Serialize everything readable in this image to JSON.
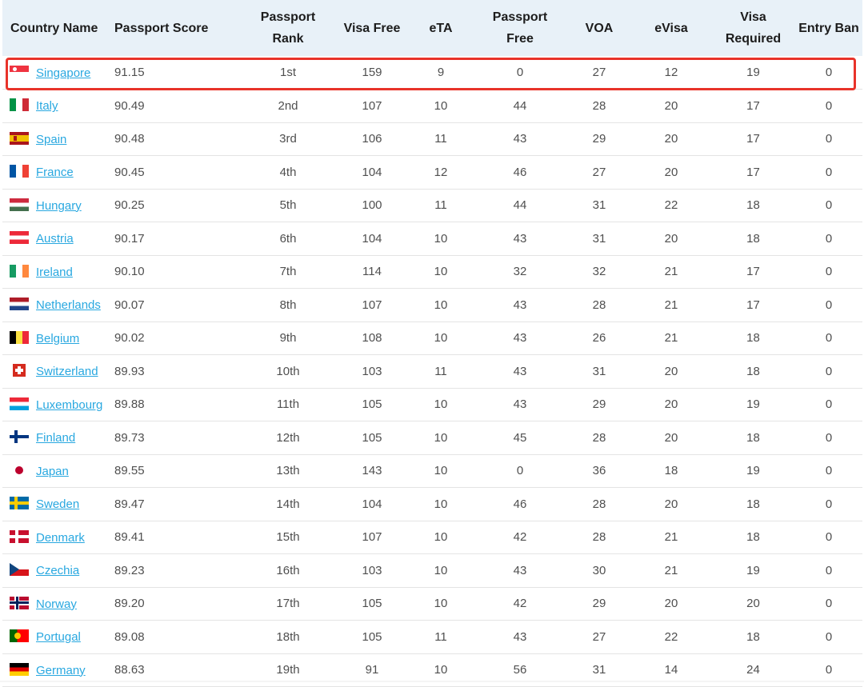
{
  "headers": {
    "country": "Country Name",
    "score": "Passport Score",
    "rank_line1": "Passport",
    "rank_line2": "Rank",
    "visa_free": "Visa Free",
    "eta": "eTA",
    "passport_free_line1": "Passport",
    "passport_free_line2": "Free",
    "voa": "VOA",
    "evisa": "eVisa",
    "visa_required_line1": "Visa",
    "visa_required_line2": "Required",
    "entry_ban": "Entry Ban"
  },
  "rows": [
    {
      "country": "Singapore",
      "flag": "sg",
      "score": "91.15",
      "rank": "1st",
      "visa_free": "159",
      "eta": "9",
      "passport_free": "0",
      "voa": "27",
      "evisa": "12",
      "visa_required": "19",
      "entry_ban": "0"
    },
    {
      "country": "Italy",
      "flag": "it",
      "score": "90.49",
      "rank": "2nd",
      "visa_free": "107",
      "eta": "10",
      "passport_free": "44",
      "voa": "28",
      "evisa": "20",
      "visa_required": "17",
      "entry_ban": "0"
    },
    {
      "country": "Spain",
      "flag": "es",
      "score": "90.48",
      "rank": "3rd",
      "visa_free": "106",
      "eta": "11",
      "passport_free": "43",
      "voa": "29",
      "evisa": "20",
      "visa_required": "17",
      "entry_ban": "0"
    },
    {
      "country": "France",
      "flag": "fr",
      "score": "90.45",
      "rank": "4th",
      "visa_free": "104",
      "eta": "12",
      "passport_free": "46",
      "voa": "27",
      "evisa": "20",
      "visa_required": "17",
      "entry_ban": "0"
    },
    {
      "country": "Hungary",
      "flag": "hu",
      "score": "90.25",
      "rank": "5th",
      "visa_free": "100",
      "eta": "11",
      "passport_free": "44",
      "voa": "31",
      "evisa": "22",
      "visa_required": "18",
      "entry_ban": "0"
    },
    {
      "country": "Austria",
      "flag": "at",
      "score": "90.17",
      "rank": "6th",
      "visa_free": "104",
      "eta": "10",
      "passport_free": "43",
      "voa": "31",
      "evisa": "20",
      "visa_required": "18",
      "entry_ban": "0"
    },
    {
      "country": "Ireland",
      "flag": "ie",
      "score": "90.10",
      "rank": "7th",
      "visa_free": "114",
      "eta": "10",
      "passport_free": "32",
      "voa": "32",
      "evisa": "21",
      "visa_required": "17",
      "entry_ban": "0"
    },
    {
      "country": "Netherlands",
      "flag": "nl",
      "score": "90.07",
      "rank": "8th",
      "visa_free": "107",
      "eta": "10",
      "passport_free": "43",
      "voa": "28",
      "evisa": "21",
      "visa_required": "17",
      "entry_ban": "0"
    },
    {
      "country": "Belgium",
      "flag": "be",
      "score": "90.02",
      "rank": "9th",
      "visa_free": "108",
      "eta": "10",
      "passport_free": "43",
      "voa": "26",
      "evisa": "21",
      "visa_required": "18",
      "entry_ban": "0"
    },
    {
      "country": "Switzerland",
      "flag": "ch",
      "score": "89.93",
      "rank": "10th",
      "visa_free": "103",
      "eta": "11",
      "passport_free": "43",
      "voa": "31",
      "evisa": "20",
      "visa_required": "18",
      "entry_ban": "0"
    },
    {
      "country": "Luxembourg",
      "flag": "lu",
      "score": "89.88",
      "rank": "11th",
      "visa_free": "105",
      "eta": "10",
      "passport_free": "43",
      "voa": "29",
      "evisa": "20",
      "visa_required": "19",
      "entry_ban": "0"
    },
    {
      "country": "Finland",
      "flag": "fi",
      "score": "89.73",
      "rank": "12th",
      "visa_free": "105",
      "eta": "10",
      "passport_free": "45",
      "voa": "28",
      "evisa": "20",
      "visa_required": "18",
      "entry_ban": "0"
    },
    {
      "country": "Japan",
      "flag": "jp",
      "score": "89.55",
      "rank": "13th",
      "visa_free": "143",
      "eta": "10",
      "passport_free": "0",
      "voa": "36",
      "evisa": "18",
      "visa_required": "19",
      "entry_ban": "0"
    },
    {
      "country": "Sweden",
      "flag": "se",
      "score": "89.47",
      "rank": "14th",
      "visa_free": "104",
      "eta": "10",
      "passport_free": "46",
      "voa": "28",
      "evisa": "20",
      "visa_required": "18",
      "entry_ban": "0"
    },
    {
      "country": "Denmark",
      "flag": "dk",
      "score": "89.41",
      "rank": "15th",
      "visa_free": "107",
      "eta": "10",
      "passport_free": "42",
      "voa": "28",
      "evisa": "21",
      "visa_required": "18",
      "entry_ban": "0"
    },
    {
      "country": "Czechia",
      "flag": "cz",
      "score": "89.23",
      "rank": "16th",
      "visa_free": "103",
      "eta": "10",
      "passport_free": "43",
      "voa": "30",
      "evisa": "21",
      "visa_required": "19",
      "entry_ban": "0"
    },
    {
      "country": "Norway",
      "flag": "no",
      "score": "89.20",
      "rank": "17th",
      "visa_free": "105",
      "eta": "10",
      "passport_free": "42",
      "voa": "29",
      "evisa": "20",
      "visa_required": "20",
      "entry_ban": "0"
    },
    {
      "country": "Portugal",
      "flag": "pt",
      "score": "89.08",
      "rank": "18th",
      "visa_free": "105",
      "eta": "11",
      "passport_free": "43",
      "voa": "27",
      "evisa": "22",
      "visa_required": "18",
      "entry_ban": "0"
    },
    {
      "country": "Germany",
      "flag": "de",
      "score": "88.63",
      "rank": "19th",
      "visa_free": "91",
      "eta": "10",
      "passport_free": "56",
      "voa": "31",
      "evisa": "14",
      "visa_required": "24",
      "entry_ban": "0"
    }
  ],
  "highlighted_row": 0,
  "colors": {
    "link": "#29a8e0",
    "header_bg": "#e8f1f8",
    "highlight": "#e8332a"
  }
}
